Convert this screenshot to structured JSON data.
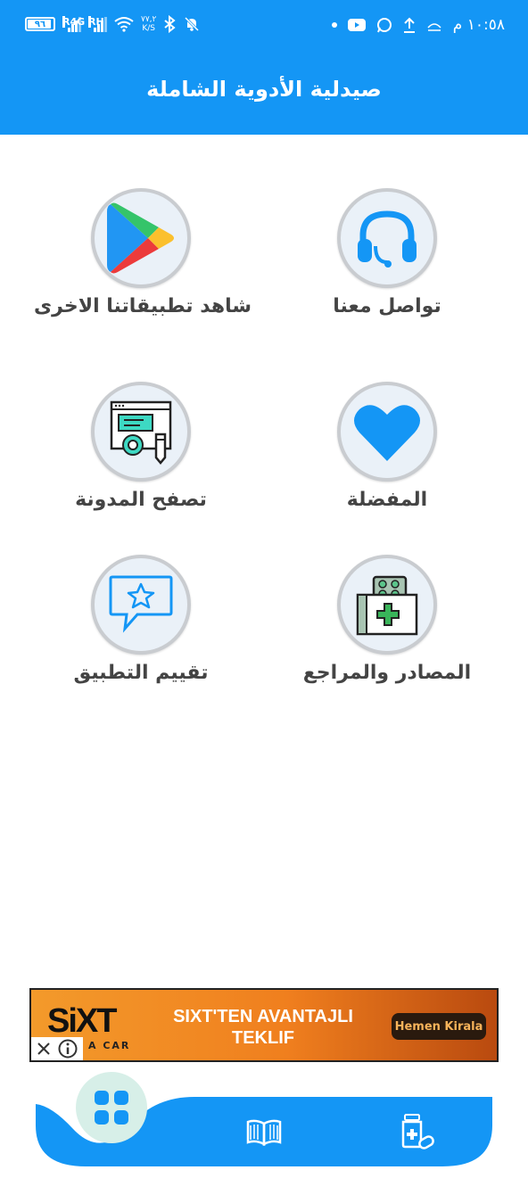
{
  "status_bar": {
    "time": "١٠:٥٨ م",
    "battery": "٩٦",
    "sim1": "R4G",
    "sim2": "RH",
    "speed_value": "٧٧,٢",
    "speed_unit": "K/S",
    "notification_icons": [
      "dot-icon",
      "youtube-icon",
      "whatsapp-icon",
      "upload-icon",
      "cloud-icon"
    ]
  },
  "header": {
    "title": "صيدلية الأدوية الشاملة",
    "color": "#1496f5"
  },
  "menu": {
    "items": [
      {
        "label": "تواصل معنا",
        "icon": "headphones-icon"
      },
      {
        "label": "شاهد تطبيقاتنا الاخرى",
        "icon": "google-play-icon"
      },
      {
        "label": "المفضلة",
        "icon": "heart-icon"
      },
      {
        "label": "تصفح المدونة",
        "icon": "blog-icon"
      },
      {
        "label": "المصادر والمراجع",
        "icon": "medicine-box-icon"
      },
      {
        "label": "تقييم التطبيق",
        "icon": "rate-star-icon"
      }
    ]
  },
  "ad": {
    "brand": "SiXT",
    "brand_sub": "A CAR",
    "headline": "SIXT'TEN AVANTAJLI TEKLIF",
    "cta": "Hemen Kirala"
  },
  "bottom_nav": {
    "items": [
      "grid-icon",
      "book-icon",
      "medicine-icon"
    ],
    "accent": "#1496f5",
    "active_bg": "#d7efe8"
  }
}
